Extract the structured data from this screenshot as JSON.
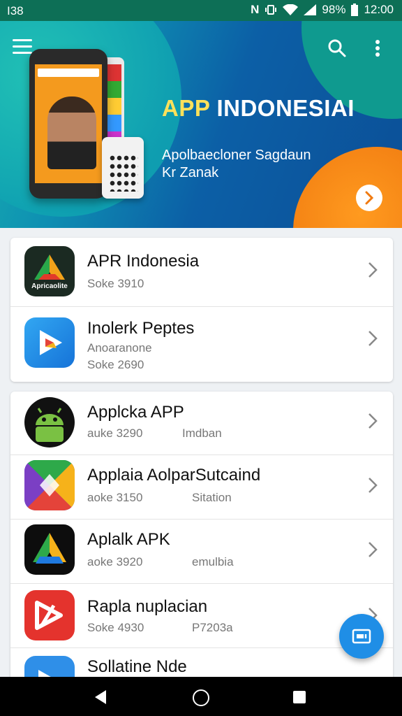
{
  "status_bar": {
    "left_text": "I38",
    "battery_text": "98%",
    "time": "12:00"
  },
  "banner": {
    "title_accent": "APP",
    "title_rest": "INDONESIAI",
    "subtitle_line1": "Apolbaecloner Sagdaun",
    "subtitle_line2": "Kr Zanak"
  },
  "card1": {
    "items": [
      {
        "title": "APR Indonesia",
        "meta": "Soke 3910",
        "icon_label": "Apricaolite"
      },
      {
        "title": "Inolerk Peptes",
        "subtitle": "Anoaranone",
        "meta": "Soke 2690"
      }
    ]
  },
  "card2": {
    "items": [
      {
        "title": "Applcka APP",
        "meta": "auke 3290",
        "meta2": "Imdban"
      },
      {
        "title": "Applaia AolparSutcaind",
        "meta": "aoke 3150",
        "meta2": "Sitation"
      },
      {
        "title": "Aplalk APK",
        "meta": "aoke 3920",
        "meta2": "emulbia"
      },
      {
        "title": "Rapla nuplacian",
        "meta": "Soke 4930",
        "meta2": "P7203a"
      },
      {
        "title": "Sollatine Nde"
      }
    ]
  },
  "colors": {
    "status_bar": "#0d6f56",
    "fab": "#1f8ee6",
    "accent_yellow": "#ffe15a",
    "orange": "#f07a10"
  }
}
